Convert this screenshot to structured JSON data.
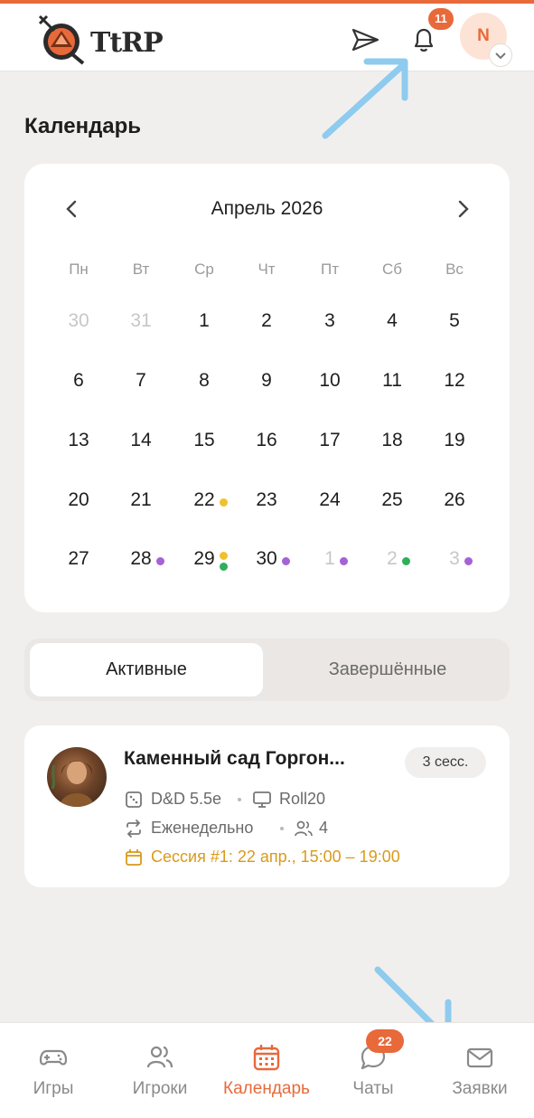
{
  "app": {
    "logo_text": "TtRP"
  },
  "header": {
    "notification_count": "11",
    "user_initial": "N",
    "icons": [
      "send-icon",
      "bell-icon",
      "chevron-down-icon"
    ]
  },
  "page": {
    "title": "Календарь"
  },
  "calendar": {
    "month_label": "Апрель 2026",
    "weekdays": [
      "Пн",
      "Вт",
      "Ср",
      "Чт",
      "Пт",
      "Сб",
      "Вс"
    ],
    "weeks": [
      [
        {
          "d": "30",
          "muted": true
        },
        {
          "d": "31",
          "muted": true
        },
        {
          "d": "1"
        },
        {
          "d": "2"
        },
        {
          "d": "3"
        },
        {
          "d": "4"
        },
        {
          "d": "5"
        }
      ],
      [
        {
          "d": "6"
        },
        {
          "d": "7"
        },
        {
          "d": "8"
        },
        {
          "d": "9"
        },
        {
          "d": "10"
        },
        {
          "d": "11"
        },
        {
          "d": "12"
        }
      ],
      [
        {
          "d": "13"
        },
        {
          "d": "14"
        },
        {
          "d": "15"
        },
        {
          "d": "16"
        },
        {
          "d": "17"
        },
        {
          "d": "18"
        },
        {
          "d": "19"
        }
      ],
      [
        {
          "d": "20"
        },
        {
          "d": "21"
        },
        {
          "d": "22",
          "dots": [
            "#f0c12e"
          ]
        },
        {
          "d": "23"
        },
        {
          "d": "24"
        },
        {
          "d": "25"
        },
        {
          "d": "26"
        }
      ],
      [
        {
          "d": "27"
        },
        {
          "d": "28",
          "dots": [
            "#a562d6"
          ]
        },
        {
          "d": "29",
          "dots": [
            "#f0c12e",
            "#2fae5b"
          ]
        },
        {
          "d": "30",
          "dots": [
            "#a562d6"
          ]
        },
        {
          "d": "1",
          "muted": true,
          "dots": [
            "#a562d6"
          ]
        },
        {
          "d": "2",
          "muted": true,
          "dots": [
            "#2fae5b"
          ]
        },
        {
          "d": "3",
          "muted": true,
          "dots": [
            "#a562d6"
          ]
        }
      ]
    ]
  },
  "tabs": {
    "active": "Активные",
    "completed": "Завершённые"
  },
  "game": {
    "title": "Каменный сад Горгон...",
    "sessions_badge": "3 сесс.",
    "system": "D&D 5.5e",
    "platform": "Roll20",
    "frequency": "Еженедельно",
    "players": "4",
    "next_session": "Сессия #1: 22 апр., 15:00 – 19:00"
  },
  "bottom_nav": {
    "items": [
      {
        "label": "Игры",
        "icon": "gamepad-icon",
        "active": false
      },
      {
        "label": "Игроки",
        "icon": "users-icon",
        "active": false
      },
      {
        "label": "Календарь",
        "icon": "calendar-icon",
        "active": true
      },
      {
        "label": "Чаты",
        "icon": "chat-icon",
        "active": false
      },
      {
        "label": "Заявки",
        "icon": "mail-icon",
        "active": false
      }
    ],
    "chat_badge": "22"
  },
  "colors": {
    "accent": "#e8693a",
    "session": "#d99a1a",
    "yellow_dot": "#f0c12e",
    "green_dot": "#2fae5b",
    "purple_dot": "#a562d6"
  }
}
